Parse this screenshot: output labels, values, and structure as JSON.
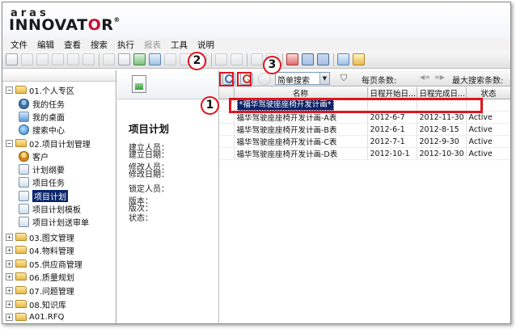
{
  "app": {
    "logo_top": "aras",
    "logo_main_a": "INNOVAT",
    "logo_main_o": "O",
    "logo_main_r": "R",
    "logo_reg": "®"
  },
  "menu": {
    "items": [
      "文件",
      "编辑",
      "查看",
      "搜索",
      "执行",
      "报表",
      "工具",
      "说明"
    ]
  },
  "tree": {
    "nodes": [
      {
        "label": "01.个人专区",
        "expander": "−",
        "kind": "folder"
      },
      {
        "label": "我的任务",
        "kind": "person"
      },
      {
        "label": "我的桌面",
        "kind": "desk"
      },
      {
        "label": "搜索中心",
        "kind": "globe"
      },
      {
        "label": "02.项目计划管理",
        "expander": "−",
        "kind": "folder"
      },
      {
        "label": "客户",
        "kind": "cust"
      },
      {
        "label": "计划纲要",
        "kind": "doc"
      },
      {
        "label": "项目任务",
        "kind": "doc"
      },
      {
        "label": "项目计划",
        "kind": "doc",
        "selected": true
      },
      {
        "label": "项目计划模板",
        "kind": "doc"
      },
      {
        "label": "项目计划送审单",
        "kind": "doc"
      },
      {
        "label": "03.图文管理",
        "expander": "+",
        "kind": "folder"
      },
      {
        "label": "04.物料管理",
        "expander": "+",
        "kind": "folder"
      },
      {
        "label": "05.供应商管理",
        "expander": "+",
        "kind": "folder"
      },
      {
        "label": "06.质量规划",
        "expander": "+",
        "kind": "folder"
      },
      {
        "label": "07.问题管理",
        "expander": "+",
        "kind": "folder"
      },
      {
        "label": "08.知识库",
        "expander": "+",
        "kind": "folder"
      },
      {
        "label": "A01.RFQ",
        "expander": "+",
        "kind": "folder"
      }
    ]
  },
  "detail": {
    "title": "项目计划",
    "fields": [
      "建立人员：",
      "建立日期：",
      "修改人员：",
      "修改日期：",
      "锁定人员：",
      "版本：",
      "版次：",
      "状态："
    ]
  },
  "grid_toolbar": {
    "search_mode": "简单搜索",
    "page_size_label": "每页条数:",
    "max_results_label": "最大搜索条数:"
  },
  "grid": {
    "columns": [
      "名称",
      "日程开始日...",
      "日程完成日...",
      "状态"
    ],
    "search_criteria": "*福华驾驶座座椅开发计画*",
    "rows": [
      {
        "name": "福华驾驶座座椅开发计画-A表",
        "start": "2012-6-7",
        "end": "2012-11-30",
        "status": "Active"
      },
      {
        "name": "福华驾驶座座椅开发计画-B表",
        "start": "2012-6-1",
        "end": "2012-8-15",
        "status": "Active"
      },
      {
        "name": "福华驾驶座座椅开发计画-C表",
        "start": "2012-7-1",
        "end": "2012-9-30",
        "status": "Active"
      },
      {
        "name": "福华驾驶座座椅开发计画-D表",
        "start": "2012-10-1",
        "end": "2012-10-30",
        "status": "Active"
      }
    ]
  },
  "annotations": {
    "callout_1": "1",
    "callout_2": "2",
    "callout_3": "3",
    "color": "#e0141c"
  }
}
